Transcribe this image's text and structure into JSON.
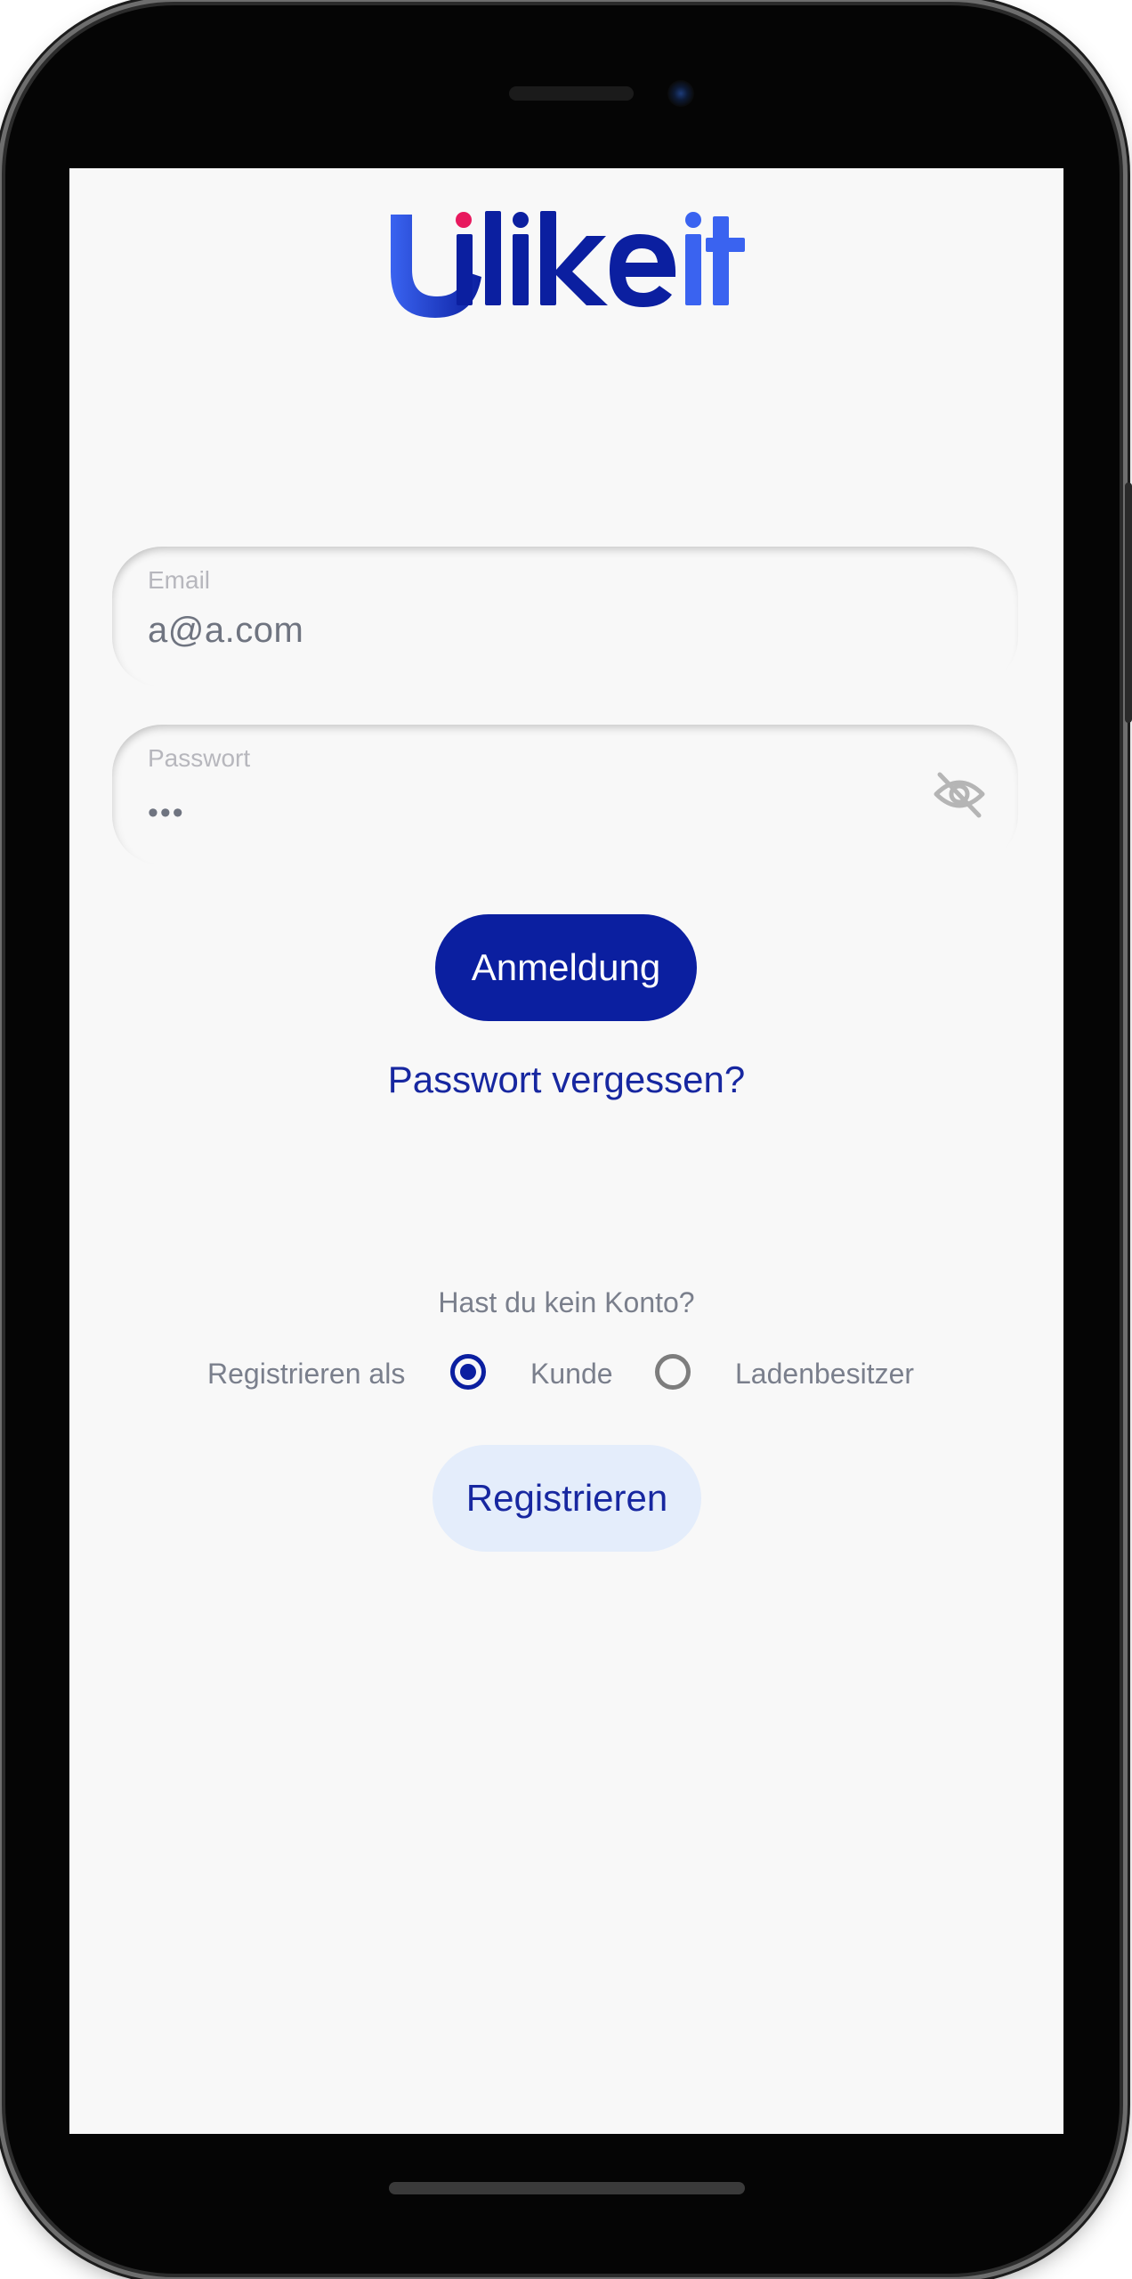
{
  "app": {
    "logo_text": "Ulikeit",
    "colors": {
      "primary": "#0b1fa0",
      "accent_blue": "#3a63f0",
      "accent_pink": "#e8195e",
      "secondary_button_bg": "#e4edfb"
    }
  },
  "login_form": {
    "email": {
      "label": "Email",
      "value": "a@a.com"
    },
    "password": {
      "label": "Passwort",
      "masked_value": "•••",
      "toggle_icon": "eye-off-icon"
    },
    "login_button": "Anmeldung",
    "forgot_password": "Passwort vergessen?"
  },
  "register": {
    "prompt": "Hast du kein Konto?",
    "register_as_label": "Registrieren als",
    "options": [
      {
        "label": "Kunde",
        "selected": true
      },
      {
        "label": "Ladenbesitzer",
        "selected": false
      }
    ],
    "register_button": "Registrieren"
  }
}
